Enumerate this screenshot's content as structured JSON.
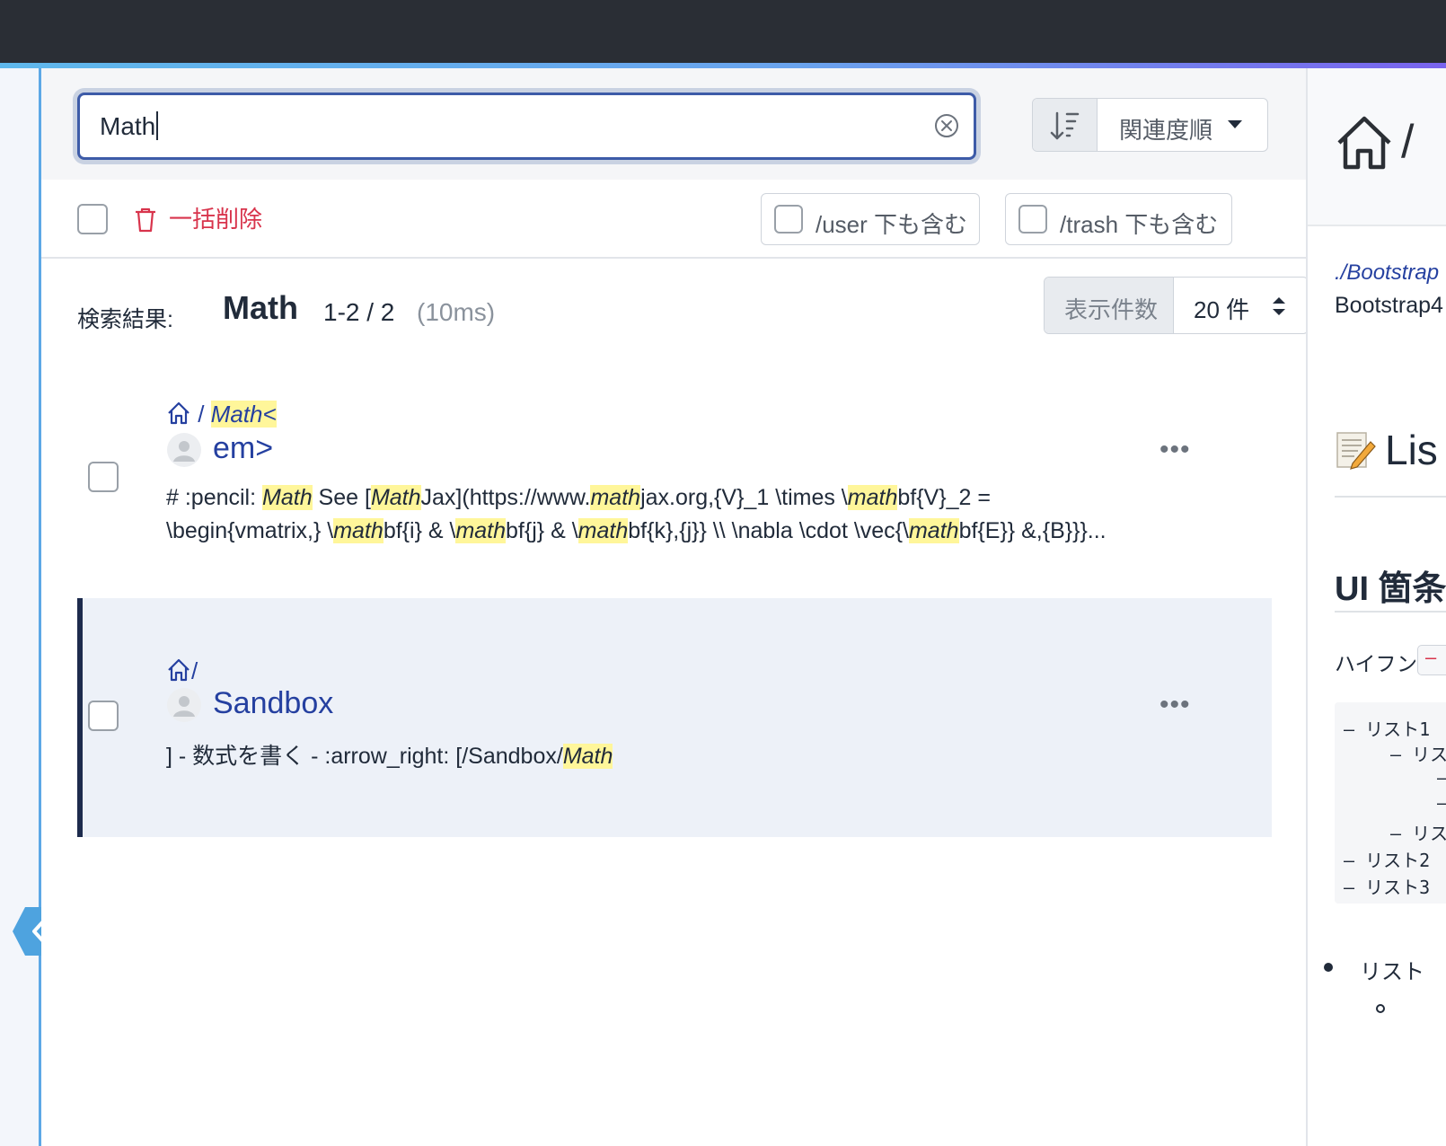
{
  "search": {
    "query": "Math",
    "sort_label": "関連度順",
    "colors": {
      "accent": "#3d5ba8",
      "danger": "#d8344c",
      "highlight": "#fff69a"
    }
  },
  "actions": {
    "bulk_delete_label": "一括削除",
    "include_user_label": "/user 下も含む",
    "include_trash_label": "/trash 下も含む"
  },
  "results": {
    "prefix": "検索結果:",
    "term": "Math",
    "range": "1-2 / 2",
    "time": "(10ms)",
    "per_page_label": "表示件数",
    "per_page_value": "20 件",
    "items": [
      {
        "crumb_sep": " / ",
        "crumb_hl": "Math<",
        "title": "em>",
        "snippet_line1": [
          "# :pencil: ",
          "Math",
          " See [",
          "Math",
          "Jax](https://www.",
          "math",
          "jax.org,{V}_1 \\times \\",
          "math",
          "bf{V}_2 ="
        ],
        "snippet_line2": [
          "\\begin{vmatrix,} \\",
          "math",
          "bf{i} & \\",
          "math",
          "bf{j} & \\",
          "math",
          "bf{k},{j}} \\\\ \\nabla \\cdot \\vec{\\",
          "math",
          "bf{E}} &,{B}}}..."
        ]
      },
      {
        "crumb_sep": "/",
        "title": "Sandbox",
        "snippet_line1": [
          "] - 数式を書く - :arrow_right: [/Sandbox/",
          "Math"
        ]
      }
    ]
  },
  "preview": {
    "slash": "/",
    "link": "./Bootstrap",
    "text": "Bootstrap4",
    "h1": "Lis",
    "h2": "UI 箇条",
    "hyphen": "ハイフン",
    "badge": "–",
    "code_lines": [
      "–  リスト1",
      "–  リス",
      "–",
      "–",
      "–  リス",
      "–  リスト2",
      "–  リスト3"
    ],
    "bullet": "リスト"
  }
}
